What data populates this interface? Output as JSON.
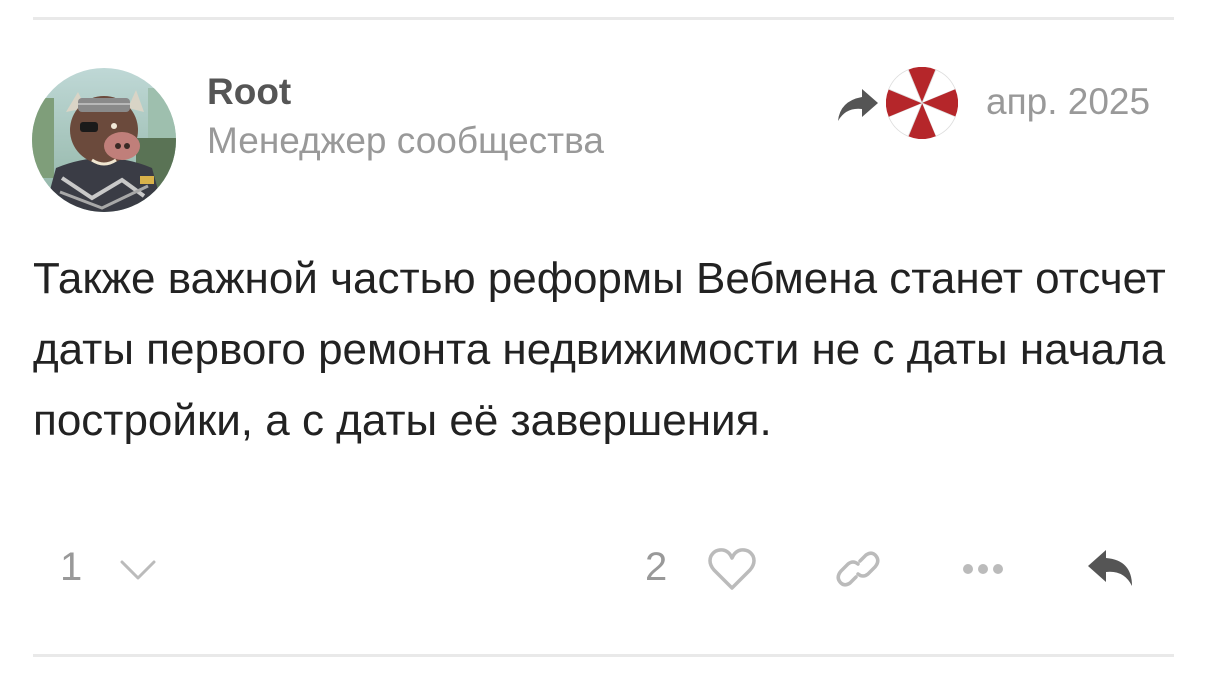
{
  "post": {
    "author": {
      "username": "Root",
      "title": "Менеджер сообщества"
    },
    "reply_to_icon": "reply-arrow-icon",
    "reply_to_avatar": "umbrella-logo",
    "date": "апр. 2025",
    "body": "Также важной частью реформы Вебмена станет отсчет даты первого ремонта недвижимости не с даты начала постройки, а с даты её завершения.",
    "actions": {
      "replies_count": "1",
      "likes_count": "2",
      "icons": [
        "chevron-down-icon",
        "heart-icon",
        "link-icon",
        "more-icon",
        "reply-icon"
      ]
    }
  },
  "colors": {
    "muted_text": "#999999",
    "body_text": "#222222",
    "username": "#555555",
    "icon_gray": "#bbbbbb",
    "reply_icon": "#555555",
    "umbrella_red": "#b5262a",
    "divider": "#e9e9e9"
  }
}
